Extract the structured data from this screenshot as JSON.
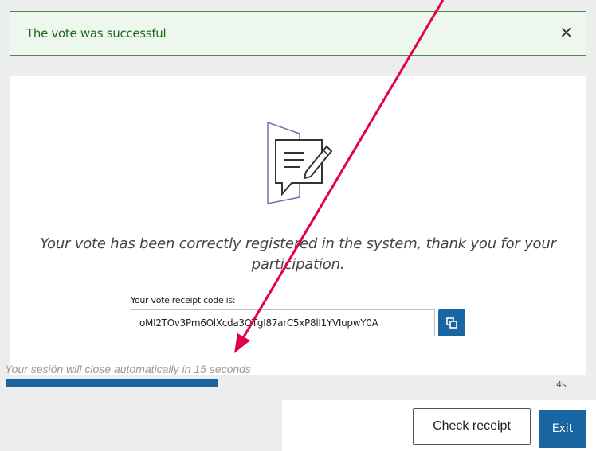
{
  "alert": {
    "message": "The vote was successful",
    "close_icon": "close-icon",
    "color": "#4c8a4c"
  },
  "main": {
    "illustration_icon": "vote-document-pen-icon",
    "message": "Your vote has been correctly registered in the system, thank you for your participation.",
    "receipt": {
      "label": "Your vote receipt code is:",
      "code": "oMI2TOv3Pm6OlXcda3OTgI87arC5xP8lI1YVIupwY0A",
      "copy_icon": "copy-icon"
    }
  },
  "session": {
    "message": "Your sesión will close automatically in 15 seconds",
    "progress_fraction": 0.4,
    "remaining": "4s"
  },
  "buttons": {
    "check_receipt": "Check receipt",
    "exit": "Exit"
  },
  "colors": {
    "accent": "#1a66a3",
    "annotation_arrow": "#e0004d"
  }
}
